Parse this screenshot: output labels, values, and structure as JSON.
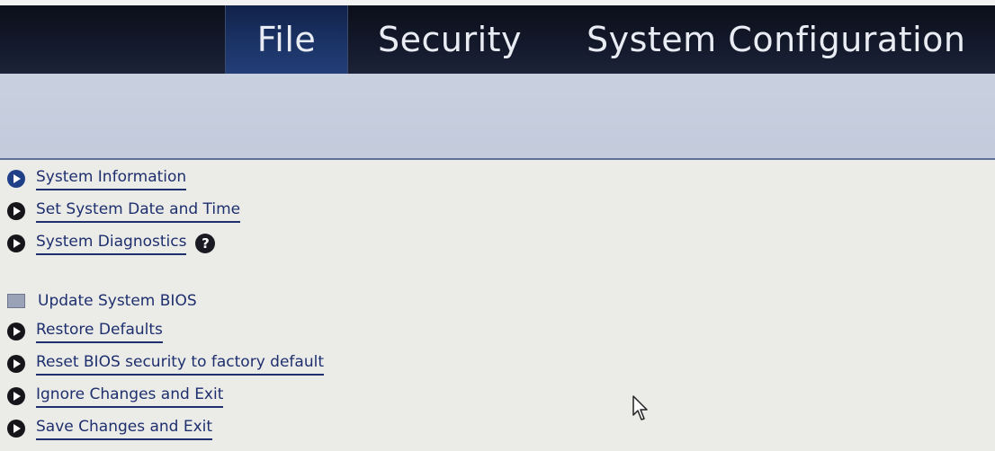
{
  "menubar": {
    "tabs": [
      {
        "label": "File",
        "selected": true
      },
      {
        "label": "Security",
        "selected": false
      },
      {
        "label": "System Configuration",
        "selected": false
      }
    ]
  },
  "menu": {
    "items": [
      {
        "label": "System Information",
        "icon": "play-bullet-icon"
      },
      {
        "label": "Set System Date and Time",
        "icon": "play-bullet-icon"
      },
      {
        "label": "System Diagnostics",
        "icon": "play-bullet-icon",
        "help_icon": "question-mark-icon",
        "help_glyph": "?"
      },
      {
        "label": "Update System BIOS",
        "icon": "square-icon"
      },
      {
        "label": "Restore Defaults",
        "icon": "play-bullet-icon"
      },
      {
        "label": "Reset BIOS security to factory default",
        "icon": "play-bullet-icon"
      },
      {
        "label": "Ignore Changes and Exit",
        "icon": "play-bullet-icon"
      },
      {
        "label": "Save Changes and Exit",
        "icon": "play-bullet-icon"
      }
    ]
  },
  "colors": {
    "menubar_bg": "#141a2c",
    "selected_tab_bg": "#1b3366",
    "header_strip_bg": "#c6cedd",
    "body_bg": "#ebebe8",
    "link_color": "#1e2f6e"
  }
}
